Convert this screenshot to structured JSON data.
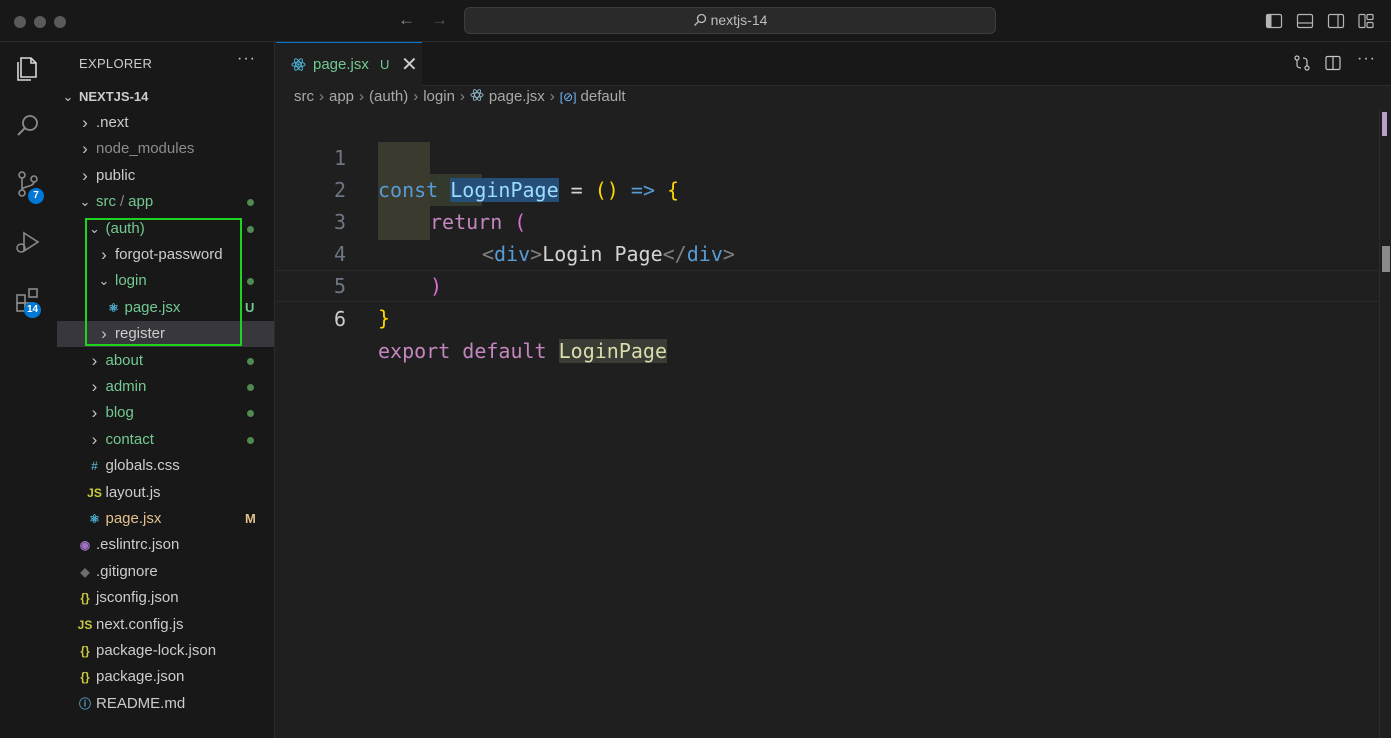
{
  "window": {
    "search_title": "nextjs-14"
  },
  "activity": {
    "source_control_badge": "7",
    "extensions_badge": "14"
  },
  "explorer": {
    "title": "EXPLORER",
    "more": "···",
    "root": "NEXTJS-14",
    "items": [
      {
        "label": ".next",
        "type": "folder",
        "expanded": false,
        "color": "#cccccc"
      },
      {
        "label": "node_modules",
        "type": "folder",
        "expanded": false,
        "color": "#8c8c8c"
      },
      {
        "label": "public",
        "type": "folder",
        "expanded": false,
        "color": "#cccccc"
      },
      {
        "label": "src",
        "sep": "/",
        "label2": "app",
        "type": "folder",
        "expanded": true,
        "color": "#73c991",
        "deco": "dot"
      },
      {
        "label": "(auth)",
        "type": "folder",
        "expanded": true,
        "color": "#73c991",
        "deco": "dot"
      },
      {
        "label": "forgot-password",
        "type": "folder",
        "expanded": false,
        "color": "#cccccc"
      },
      {
        "label": "login",
        "type": "folder",
        "expanded": true,
        "color": "#73c991",
        "deco": "dot"
      },
      {
        "label": "page.jsx",
        "type": "react",
        "color": "#73c991",
        "deco": "U"
      },
      {
        "label": "register",
        "type": "folder",
        "expanded": false,
        "color": "#cccccc",
        "selected": true
      },
      {
        "label": "about",
        "type": "folder",
        "expanded": false,
        "color": "#73c991",
        "deco": "dot"
      },
      {
        "label": "admin",
        "type": "folder",
        "expanded": false,
        "color": "#73c991",
        "deco": "dot"
      },
      {
        "label": "blog",
        "type": "folder",
        "expanded": false,
        "color": "#73c991",
        "deco": "dot"
      },
      {
        "label": "contact",
        "type": "folder",
        "expanded": false,
        "color": "#73c991",
        "deco": "dot"
      },
      {
        "label": "globals.css",
        "type": "css",
        "color": "#cccccc"
      },
      {
        "label": "layout.js",
        "type": "js",
        "color": "#cccccc"
      },
      {
        "label": "page.jsx",
        "type": "react",
        "color": "#e2c08d",
        "deco": "M"
      },
      {
        "label": ".eslintrc.json",
        "type": "eslint",
        "color": "#cccccc"
      },
      {
        "label": ".gitignore",
        "type": "git",
        "color": "#cccccc"
      },
      {
        "label": "jsconfig.json",
        "type": "json",
        "color": "#cccccc"
      },
      {
        "label": "next.config.js",
        "type": "js",
        "color": "#cccccc"
      },
      {
        "label": "package-lock.json",
        "type": "json",
        "color": "#cccccc"
      },
      {
        "label": "package.json",
        "type": "json",
        "color": "#cccccc"
      },
      {
        "label": "README.md",
        "type": "info",
        "color": "#cccccc"
      }
    ]
  },
  "tab": {
    "label": "page.jsx",
    "status": "U",
    "close": "✕"
  },
  "breadcrumb": {
    "parts": [
      "src",
      "app",
      "(auth)",
      "login",
      "page.jsx",
      "default"
    ]
  },
  "code": {
    "line_numbers": [
      "1",
      "2",
      "3",
      "4",
      "5",
      "6"
    ],
    "l1": {
      "const": "const",
      "name": "LoginPage",
      "eq": " = ",
      "open": "()",
      "arrow": " => ",
      "brace": "{"
    },
    "l2": {
      "ret": "return",
      "paren": "("
    },
    "l3": {
      "lt1": "<",
      "tag1": "div",
      "gt1": ">",
      "text": "Login Page",
      "lt2": "</",
      "tag2": "div",
      "gt2": ">"
    },
    "l4": {
      "paren": ")"
    },
    "l5": {
      "brace": "}"
    },
    "l6": {
      "export": "export",
      "default": "default",
      "name": "LoginPage"
    }
  }
}
